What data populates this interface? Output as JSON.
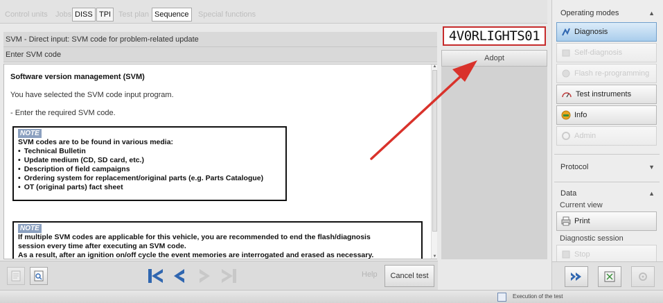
{
  "tabs": [
    {
      "label": "Control units",
      "state": "disabled"
    },
    {
      "label": "Jobs",
      "state": "disabled"
    },
    {
      "label": "DISS",
      "state": "enabled"
    },
    {
      "label": "TPI",
      "state": "enabled"
    },
    {
      "label": "Test plan",
      "state": "disabled"
    },
    {
      "label": "Sequence",
      "state": "selected"
    },
    {
      "label": "Special functions",
      "state": "disabled"
    }
  ],
  "header": {
    "title": "SVM - Direct input: SVM code for problem-related update",
    "subtitle": "Enter SVM code"
  },
  "svm_input": {
    "value": "4V0RLIGHTS01"
  },
  "adopt_label": "Adopt",
  "content": {
    "heading": "Software version management (SVM)",
    "line1": "You have selected the SVM code input program.",
    "line2": "- Enter the required SVM code.",
    "note1": {
      "badge": "NOTE",
      "intro": "SVM codes are to be found in various media:",
      "items": [
        "Technical Bulletin",
        "Update medium (CD, SD card, etc.)",
        "Description of field campaigns",
        "Ordering system for replacement/original parts (e.g. Parts Catalogue)",
        "OT (original parts) fact sheet"
      ]
    },
    "note2": {
      "badge": "NOTE",
      "line1": "If multiple SVM codes are applicable for this vehicle, you are recommended to end the flash/diagnosis",
      "line2": "session every time after executing an SVM code.",
      "line3": "As a result, after an ignition on/off cycle the event memories are interrogated and erased as necessary."
    }
  },
  "bottom": {
    "help_label": "Help",
    "cancel_label": "Cancel test"
  },
  "right_panel": {
    "operating_modes": "Operating modes",
    "modes": [
      {
        "label": "Diagnosis",
        "state": "selected"
      },
      {
        "label": "Self-diagnosis",
        "state": "disabled"
      },
      {
        "label": "Flash re-programming",
        "state": "disabled"
      },
      {
        "label": "Test instruments",
        "state": "enabled"
      },
      {
        "label": "Info",
        "state": "enabled"
      },
      {
        "label": "Admin",
        "state": "disabled"
      }
    ],
    "protocol": "Protocol",
    "data": "Data",
    "current_view": "Current view",
    "print_label": "Print",
    "diagnostic_session": "Diagnostic session",
    "stop_label": "Stop"
  },
  "status": {
    "text": "Execution of the test"
  },
  "colors": {
    "accent": "#2f66b0",
    "highlight": "#c62b2b",
    "selected_mode": "#a9cdec"
  }
}
